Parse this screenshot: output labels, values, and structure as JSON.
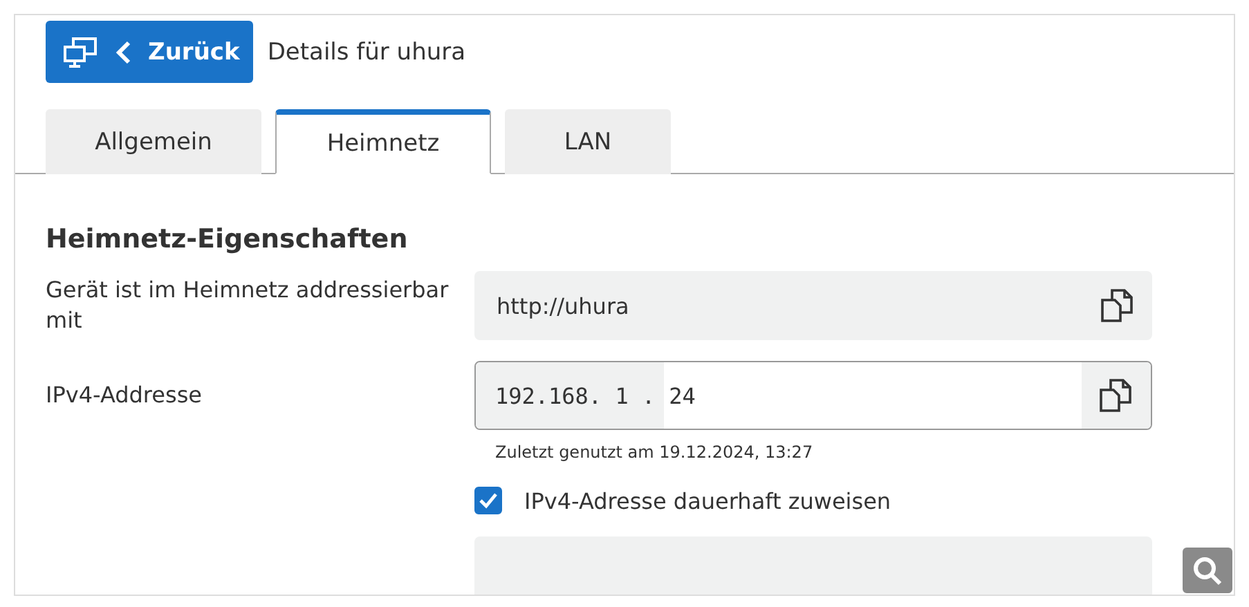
{
  "header": {
    "back_button": "Zurück",
    "title": "Details für uhura"
  },
  "tabs": [
    {
      "label": "Allgemein",
      "selected": false
    },
    {
      "label": "Heimnetz",
      "selected": true
    },
    {
      "label": "LAN",
      "selected": false
    }
  ],
  "section": {
    "heading": "Heimnetz-Eigenschaften",
    "rows": [
      {
        "kind": "readonly",
        "label": "Gerät ist im Heimnetz addressierbar mit",
        "value": "http://uhura"
      },
      {
        "kind": "ip",
        "label": "IPv4-Addresse",
        "prefix": "192.168. 1 .",
        "value": "24",
        "note": "Zuletzt genutzt am 19.12.2024, 13:27"
      },
      {
        "kind": "checkbox",
        "label": "IPv4-Adresse dauerhaft zuweisen",
        "checked": true
      },
      {
        "kind": "cutoff"
      }
    ]
  }
}
